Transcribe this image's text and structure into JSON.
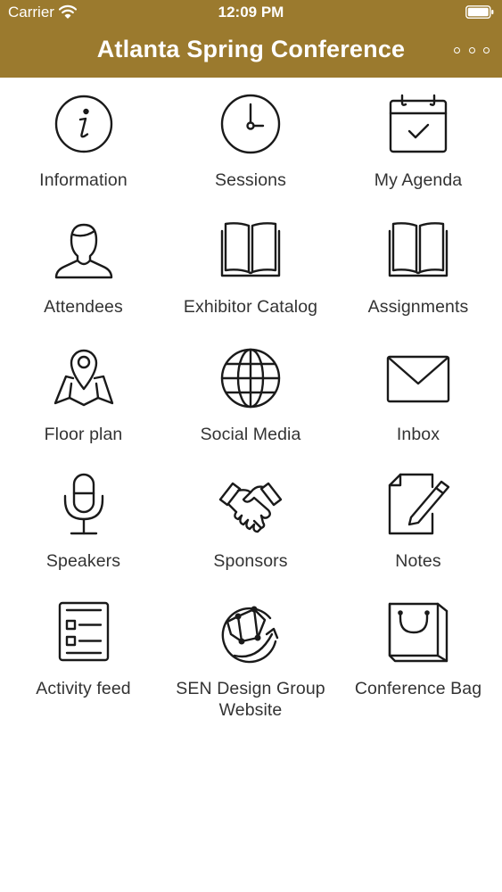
{
  "status_bar": {
    "carrier": "Carrier",
    "time": "12:09 PM"
  },
  "header": {
    "title": "Atlanta Spring Conference"
  },
  "colors": {
    "header_bg": "#9b7a2e",
    "header_text": "#ffffff"
  },
  "menu": [
    {
      "label": "Information",
      "icon": "info-icon"
    },
    {
      "label": "Sessions",
      "icon": "clock-icon"
    },
    {
      "label": "My Agenda",
      "icon": "calendar-check-icon"
    },
    {
      "label": "Attendees",
      "icon": "person-icon"
    },
    {
      "label": "Exhibitor Catalog",
      "icon": "book-icon"
    },
    {
      "label": "Assignments",
      "icon": "book-icon"
    },
    {
      "label": "Floor plan",
      "icon": "map-pin-icon"
    },
    {
      "label": "Social Media",
      "icon": "globe-icon"
    },
    {
      "label": "Inbox",
      "icon": "envelope-icon"
    },
    {
      "label": "Speakers",
      "icon": "microphone-icon"
    },
    {
      "label": "Sponsors",
      "icon": "handshake-icon"
    },
    {
      "label": "Notes",
      "icon": "note-pencil-icon"
    },
    {
      "label": "Activity feed",
      "icon": "list-card-icon"
    },
    {
      "label": "SEN Design Group Website",
      "icon": "network-globe-icon"
    },
    {
      "label": "Conference Bag",
      "icon": "shopping-bag-icon"
    }
  ]
}
